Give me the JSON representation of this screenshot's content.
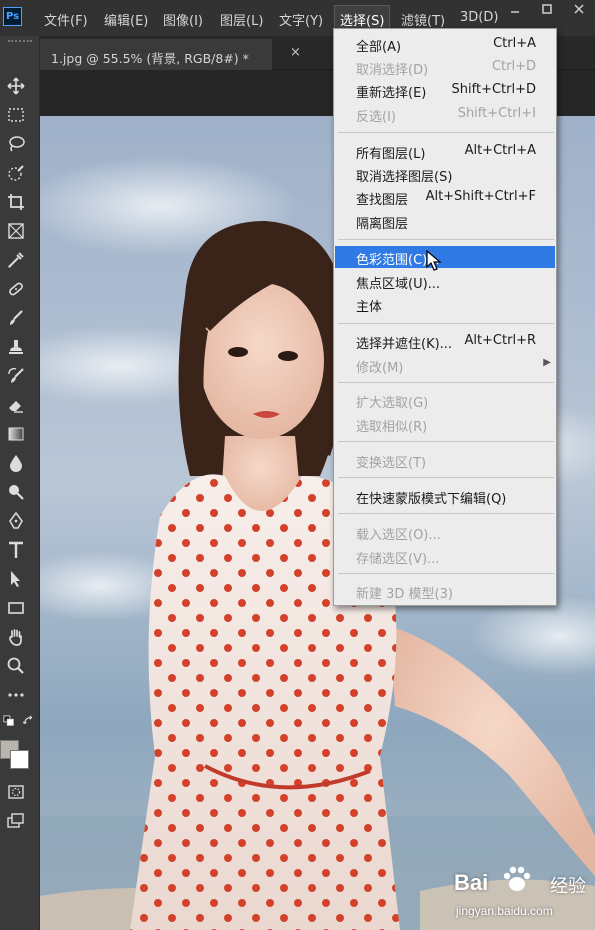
{
  "app": {
    "logo": "Ps"
  },
  "menubar": {
    "items": [
      {
        "label": "文件(F)"
      },
      {
        "label": "编辑(E)"
      },
      {
        "label": "图像(I)"
      },
      {
        "label": "图层(L)"
      },
      {
        "label": "文字(Y)"
      },
      {
        "label": "选择(S)",
        "active": true
      },
      {
        "label": "滤镜(T)"
      },
      {
        "label": "3D(D)"
      }
    ],
    "window_buttons": [
      "minimize",
      "maximize",
      "close"
    ]
  },
  "document_tab": {
    "title": "1.jpg @ 55.5% (背景, RGB/8#) *",
    "close": "×"
  },
  "toolbar": {
    "tools": [
      "move-icon",
      "marquee-icon",
      "lasso-icon",
      "quick-select-icon",
      "crop-icon",
      "frame-icon",
      "eyedropper-icon",
      "healing-brush-icon",
      "brush-icon",
      "clone-stamp-icon",
      "history-brush-icon",
      "eraser-icon",
      "gradient-icon",
      "blur-icon",
      "dodge-icon",
      "pen-icon",
      "type-icon",
      "path-select-icon",
      "rectangle-icon",
      "hand-icon",
      "zoom-icon",
      "more-tools-icon",
      "quick-mask-icon",
      "screen-mode-icon"
    ],
    "foreground_color": "#b9b5ad",
    "background_color": "#ffffff"
  },
  "select_menu": {
    "items": [
      {
        "label": "全部(A)",
        "shortcut": "Ctrl+A",
        "disabled": false
      },
      {
        "label": "取消选择(D)",
        "shortcut": "Ctrl+D",
        "disabled": true
      },
      {
        "label": "重新选择(E)",
        "shortcut": "Shift+Ctrl+D",
        "disabled": false
      },
      {
        "label": "反选(I)",
        "shortcut": "Shift+Ctrl+I",
        "disabled": true
      },
      {
        "label": "所有图层(L)",
        "shortcut": "Alt+Ctrl+A",
        "disabled": false
      },
      {
        "label": "取消选择图层(S)",
        "shortcut": "",
        "disabled": false
      },
      {
        "label": "查找图层",
        "shortcut": "Alt+Shift+Ctrl+F",
        "disabled": false
      },
      {
        "label": "隔离图层",
        "shortcut": "",
        "disabled": false
      },
      {
        "label": "色彩范围(C)...",
        "shortcut": "",
        "disabled": false,
        "highlighted": true
      },
      {
        "label": "焦点区域(U)...",
        "shortcut": "",
        "disabled": false
      },
      {
        "label": "主体",
        "shortcut": "",
        "disabled": false
      },
      {
        "label": "选择并遮住(K)...",
        "shortcut": "Alt+Ctrl+R",
        "disabled": false
      },
      {
        "label": "修改(M)",
        "shortcut": "",
        "disabled": true,
        "submenu": true
      },
      {
        "label": "扩大选取(G)",
        "shortcut": "",
        "disabled": true
      },
      {
        "label": "选取相似(R)",
        "shortcut": "",
        "disabled": true
      },
      {
        "label": "变换选区(T)",
        "shortcut": "",
        "disabled": true
      },
      {
        "label": "在快速蒙版模式下编辑(Q)",
        "shortcut": "",
        "disabled": false
      },
      {
        "label": "载入选区(O)...",
        "shortcut": "",
        "disabled": true
      },
      {
        "label": "存储选区(V)...",
        "shortcut": "",
        "disabled": true
      },
      {
        "label": "新建 3D 模型(3)",
        "shortcut": "",
        "disabled": true
      }
    ],
    "highlight_color": "#2f7ae5",
    "submenu_arrow": "▶"
  },
  "watermark": {
    "logo_left": "Bai",
    "logo_right": "经验",
    "url": "jingyan.baidu.com"
  }
}
